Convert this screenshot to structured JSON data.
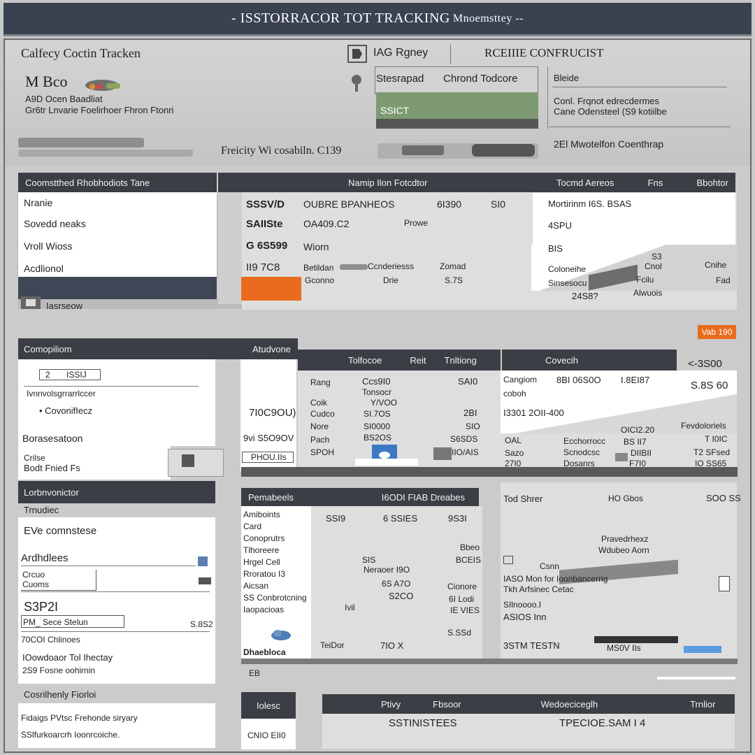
{
  "window": {
    "title": "- ISSTORRACOR TOT TRACKING",
    "subtitle": "Mnoemsttey --"
  },
  "header": {
    "brand_title": "Calfecy Coctin Tracken",
    "brand_logo": "M Bco",
    "brand_line1": "A9D Ocen Baadliat",
    "brand_line2": "Gr6tr Lnvarie Foelirhoer Fhron Ftonri",
    "tag_label": "IAG Rgney",
    "status_label": "Stesrapad",
    "status_value": "Chrond Todcore",
    "green_value": "SSICT",
    "rail_text": "Freicity Wi cosabiln. C139",
    "right_title": "RCEIIIE CONFRUCIST",
    "right_label": "Bleide",
    "right_line1": "Conl. Frqnot edrecdermes",
    "right_line2": "Cane Odensteel (S9 kotiilbe",
    "right_line3": "2El Mwotelfon Coenthrap"
  },
  "left_top": {
    "header": "Coomstthed Rhobhodiots Tane",
    "items": [
      "Nranie",
      "Sovedd neaks",
      "Vroll Wioss",
      "Acdlionol"
    ],
    "footer": "Iasrseow"
  },
  "mid_top": {
    "header": "Namip Ilon Fotcdtor",
    "rows": [
      {
        "id": "SSSV/D",
        "name": "OUBRE BPANHEOS",
        "c1": "6I390",
        "c2": "SI0"
      },
      {
        "id": "SAIISte",
        "name": "OA409.C2",
        "c1": "Prowe",
        "c2": ""
      },
      {
        "id": "G 6S599",
        "name": "Wiorn",
        "c1": "",
        "c2": ""
      },
      {
        "id": "II9 7C8",
        "name": "Betildan",
        "c1": "Ccnderiesss",
        "c2": "Zomad"
      },
      {
        "id": "",
        "name": "Gconno",
        "c1": "Drie",
        "c2": "S.7S"
      }
    ]
  },
  "right_top": {
    "header_a": "Tocmd Aereos",
    "header_b": "Fns",
    "header_c": "Bbohtor",
    "line1": "Mortirinm I6S. BSAS",
    "v1": "4SPU",
    "v2": "BIS",
    "label1": "Coloneihe",
    "label2": "Sinsesocu",
    "label3": "Fcilu",
    "label4": "Alwuois",
    "n1": "S3",
    "n2": "Cnol",
    "n3": "Cnihe",
    "n4": "Fad",
    "amount": "24S8?",
    "badge": "Vab 190"
  },
  "left_mid": {
    "header": "Comopiliom",
    "chip1": "2",
    "chip2": "ISSIJ",
    "line1": "Ivnnvolsgrrarrlccer",
    "line2": "CovonifIecz",
    "label": "Borasesatoon",
    "sub1": "Crilse",
    "sub2": "Bodt Fnied Fs"
  },
  "mid_mid": {
    "header": "Atudvone",
    "value": "7I0C9OU)",
    "field": "9vi S5O9OV",
    "field2": "PHOU.IIs"
  },
  "center_table": {
    "header_a": "Tolfocoe",
    "header_b": "Reit",
    "header_c": "Tnltiong",
    "rows": [
      [
        "Rang",
        "Ccs9I0",
        "SAI0"
      ],
      [
        "",
        "Tonsocr",
        ""
      ],
      [
        "Coik",
        "Y/VOO",
        ""
      ],
      [
        "Cudco",
        "SI.7OS",
        "2BI"
      ],
      [
        "Nore",
        "SI0000",
        "SIO"
      ],
      [
        "Pach",
        "BS2OS",
        "S6SDS"
      ],
      [
        "SPOH",
        "",
        "IIO/AIS"
      ]
    ]
  },
  "right_mid": {
    "header": "Covecih",
    "top_value": "<-3S00",
    "r1a": "Cangiom",
    "r1b": "8BI 06S0O",
    "r1c": "I.8EI87",
    "r1d": "S.8S 60",
    "r2a": "coboh",
    "r3": "I3301 2OII-400",
    "a1": "OICI2.20",
    "a2": "BS II7",
    "a3": "DIIBII",
    "a4": "F7I0",
    "b1": "Fevdoloriels",
    "b2": "T I0IC",
    "b3": "T2 SFsed",
    "b4": "IO SS65",
    "c1": "OAL",
    "c2": "Sazo",
    "c3": "27I0",
    "d1": "Ecchorrocc",
    "d2": "Scnodcsc",
    "d3": "Dosanrs"
  },
  "left_low": {
    "header": "Lorbnvonictor",
    "subheader": "Trnudiec",
    "line1": "EVe comnstese",
    "line2": "Ardhdlees",
    "field1": "Crcuo",
    "field2": "Cuoms",
    "code": "S3P2I",
    "input": "PM_ Sece Stelun",
    "right_val": "S.8S2",
    "line3": "70COI Chlinoes",
    "line4": "IOowdoaor Tol Ihectay",
    "line5": "2S9 Fosne oohirnin"
  },
  "mid_low": {
    "header": "Pemabeels",
    "header2": "I6ODI FIAB Dreabes",
    "list": [
      "Amiboints",
      "Card",
      "Conoprutrs",
      "Tlhoreere",
      "Hrgel Cell",
      "Rroratou I3",
      "Aicsan",
      "SS Conbrotcning",
      "Iaopacioas"
    ],
    "footer": "Dhaebloca",
    "cols": [
      [
        "SSI9",
        "",
        "",
        "",
        "Neraoer I9O",
        "6S A7O",
        "S2CO",
        "",
        "TeiDor"
      ],
      [
        "6 SSIES",
        "",
        "SIS",
        "",
        "",
        "",
        "",
        "Ivil",
        "7IO X"
      ],
      [
        "9S3I",
        "Bbeo",
        "BCEIS",
        "",
        "",
        "Cionore",
        "6I Lodi",
        "IE VIES",
        "S.SSd"
      ]
    ]
  },
  "right_low": {
    "header": "Tod Shrer",
    "h2": "HO Gbos",
    "h3": "SOO SS",
    "l1": "Pravedrhexz",
    "l2": "Wdubeo Aorn",
    "l3": "Csnn",
    "l4": "IASO Mon for Ioonbancerrig",
    "l5": "Tkh Arfsinec Cetac",
    "l6": "SIlnoooo.I",
    "l7": "ASIOS Inn",
    "l8": "3STM TESTN",
    "l9": "MS0V IIs"
  },
  "bottom": {
    "left_header": "Cosrilhenly Fiorloi",
    "left_line1": "Fidaigs PVtsc Frehonde siryary",
    "left_line2": "SSlfurkoarcrh Ioonrcoiche.",
    "mid_label": "EB",
    "mid_header": "Iolesc",
    "mid_value": "CNIO EII0",
    "hdr_a": "Ptivy",
    "hdr_b": "Fbsoor",
    "hdr_c": "Wedoeciceglh",
    "hdr_d": "Trnlior",
    "val_a": "SSTINISTEES",
    "val_b": "TPECIOE.SAM I 4"
  }
}
